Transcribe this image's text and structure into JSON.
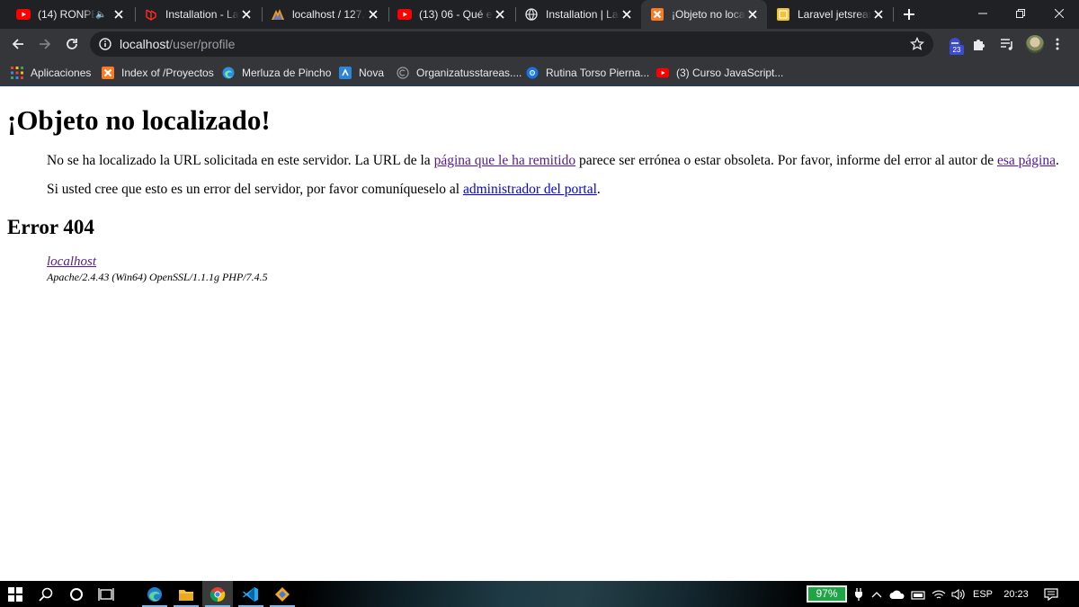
{
  "browser": {
    "tabs": [
      {
        "title": "(14) RONPE",
        "favicon": "youtube-icon",
        "muted": true
      },
      {
        "title": "Installation - Lar",
        "favicon": "laravel-icon"
      },
      {
        "title": "localhost / 127.0",
        "favicon": "phpmyadmin-icon"
      },
      {
        "title": "(13) 06 - Qué es",
        "favicon": "youtube-icon"
      },
      {
        "title": "Installation | Lar",
        "favicon": "globe-icon"
      },
      {
        "title": "¡Objeto no locali",
        "favicon": "xampp-icon",
        "active": true
      },
      {
        "title": "Laravel jetsream",
        "favicon": "bookmark-favicon"
      }
    ],
    "address": {
      "host": "localhost",
      "path": "/user/profile"
    },
    "extensions_badge": "23",
    "bookmarks": [
      {
        "label": "Aplicaciones",
        "icon": "apps-grid-icon"
      },
      {
        "label": "Index of /Proyectos",
        "icon": "xampp-icon"
      },
      {
        "label": "Merluza de Pincho",
        "icon": "edge-icon"
      },
      {
        "label": "Nova",
        "icon": "nova-icon"
      },
      {
        "label": "Organizatusstareas....",
        "icon": "copyright-icon"
      },
      {
        "label": "Rutina Torso Pierna...",
        "icon": "chrome-icon"
      },
      {
        "label": "(3) Curso JavaScript...",
        "icon": "youtube-icon"
      }
    ]
  },
  "page": {
    "heading": "¡Objeto no localizado!",
    "para1": {
      "before": "No se ha localizado la URL solicitada en este servidor. La URL de la ",
      "link1": "página que le ha remitido",
      "middle": " parece ser errónea o estar obsoleta. Por favor, informe del error al autor de ",
      "link2": "esa página",
      "after": "."
    },
    "para2": {
      "before": "Si usted cree que esto es un error del servidor, por favor comuníqueselo al ",
      "link": "administrador del portal",
      "after": "."
    },
    "error_title": "Error 404",
    "server_link": "localhost",
    "server_signature": "Apache/2.4.43 (Win64) OpenSSL/1.1.1g PHP/7.4.5"
  },
  "taskbar": {
    "battery": "97%",
    "language": "ESP",
    "time": "20:23"
  },
  "colors": {
    "tabstrip": "#202124",
    "toolbar": "#35363a",
    "link_visited": "#551a8b",
    "link_unvisited": "#0000ee",
    "battery": "#1fa545"
  }
}
